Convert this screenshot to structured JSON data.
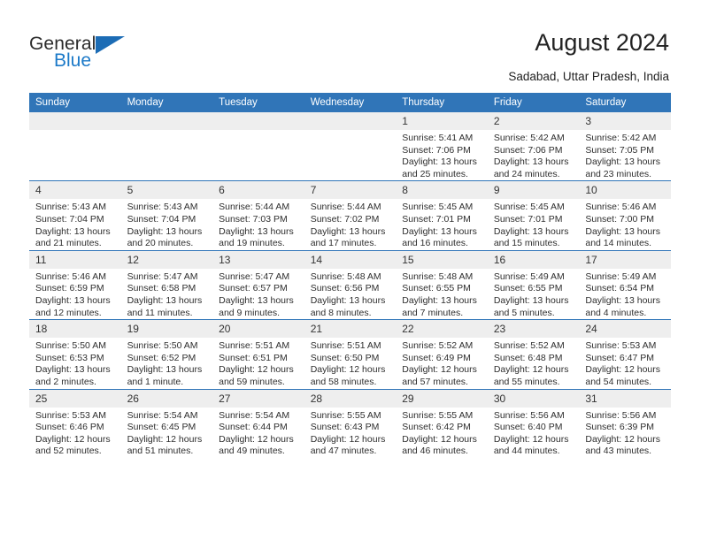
{
  "brand": {
    "name_part1": "General",
    "name_part2": "Blue",
    "logo_icon": "triangle-logo-icon"
  },
  "header": {
    "title": "August 2024",
    "location": "Sadabad, Uttar Pradesh, India"
  },
  "calendar": {
    "weekday_headers": [
      "Sunday",
      "Monday",
      "Tuesday",
      "Wednesday",
      "Thursday",
      "Friday",
      "Saturday"
    ],
    "colors": {
      "header_blue": "#3075b8",
      "daynum_band": "#eeeeee",
      "brand_blue": "#1b79c8",
      "text": "#222222"
    },
    "labels": {
      "sunrise_prefix": "Sunrise:",
      "sunset_prefix": "Sunset:",
      "daylight_prefix": "Daylight:"
    },
    "weeks": [
      [
        {
          "day": "",
          "lines": []
        },
        {
          "day": "",
          "lines": []
        },
        {
          "day": "",
          "lines": []
        },
        {
          "day": "",
          "lines": []
        },
        {
          "day": "1",
          "lines": [
            "Sunrise: 5:41 AM",
            "Sunset: 7:06 PM",
            "Daylight: 13 hours and 25 minutes."
          ]
        },
        {
          "day": "2",
          "lines": [
            "Sunrise: 5:42 AM",
            "Sunset: 7:06 PM",
            "Daylight: 13 hours and 24 minutes."
          ]
        },
        {
          "day": "3",
          "lines": [
            "Sunrise: 5:42 AM",
            "Sunset: 7:05 PM",
            "Daylight: 13 hours and 23 minutes."
          ]
        }
      ],
      [
        {
          "day": "4",
          "lines": [
            "Sunrise: 5:43 AM",
            "Sunset: 7:04 PM",
            "Daylight: 13 hours and 21 minutes."
          ]
        },
        {
          "day": "5",
          "lines": [
            "Sunrise: 5:43 AM",
            "Sunset: 7:04 PM",
            "Daylight: 13 hours and 20 minutes."
          ]
        },
        {
          "day": "6",
          "lines": [
            "Sunrise: 5:44 AM",
            "Sunset: 7:03 PM",
            "Daylight: 13 hours and 19 minutes."
          ]
        },
        {
          "day": "7",
          "lines": [
            "Sunrise: 5:44 AM",
            "Sunset: 7:02 PM",
            "Daylight: 13 hours and 17 minutes."
          ]
        },
        {
          "day": "8",
          "lines": [
            "Sunrise: 5:45 AM",
            "Sunset: 7:01 PM",
            "Daylight: 13 hours and 16 minutes."
          ]
        },
        {
          "day": "9",
          "lines": [
            "Sunrise: 5:45 AM",
            "Sunset: 7:01 PM",
            "Daylight: 13 hours and 15 minutes."
          ]
        },
        {
          "day": "10",
          "lines": [
            "Sunrise: 5:46 AM",
            "Sunset: 7:00 PM",
            "Daylight: 13 hours and 14 minutes."
          ]
        }
      ],
      [
        {
          "day": "11",
          "lines": [
            "Sunrise: 5:46 AM",
            "Sunset: 6:59 PM",
            "Daylight: 13 hours and 12 minutes."
          ]
        },
        {
          "day": "12",
          "lines": [
            "Sunrise: 5:47 AM",
            "Sunset: 6:58 PM",
            "Daylight: 13 hours and 11 minutes."
          ]
        },
        {
          "day": "13",
          "lines": [
            "Sunrise: 5:47 AM",
            "Sunset: 6:57 PM",
            "Daylight: 13 hours and 9 minutes."
          ]
        },
        {
          "day": "14",
          "lines": [
            "Sunrise: 5:48 AM",
            "Sunset: 6:56 PM",
            "Daylight: 13 hours and 8 minutes."
          ]
        },
        {
          "day": "15",
          "lines": [
            "Sunrise: 5:48 AM",
            "Sunset: 6:55 PM",
            "Daylight: 13 hours and 7 minutes."
          ]
        },
        {
          "day": "16",
          "lines": [
            "Sunrise: 5:49 AM",
            "Sunset: 6:55 PM",
            "Daylight: 13 hours and 5 minutes."
          ]
        },
        {
          "day": "17",
          "lines": [
            "Sunrise: 5:49 AM",
            "Sunset: 6:54 PM",
            "Daylight: 13 hours and 4 minutes."
          ]
        }
      ],
      [
        {
          "day": "18",
          "lines": [
            "Sunrise: 5:50 AM",
            "Sunset: 6:53 PM",
            "Daylight: 13 hours and 2 minutes."
          ]
        },
        {
          "day": "19",
          "lines": [
            "Sunrise: 5:50 AM",
            "Sunset: 6:52 PM",
            "Daylight: 13 hours and 1 minute."
          ]
        },
        {
          "day": "20",
          "lines": [
            "Sunrise: 5:51 AM",
            "Sunset: 6:51 PM",
            "Daylight: 12 hours and 59 minutes."
          ]
        },
        {
          "day": "21",
          "lines": [
            "Sunrise: 5:51 AM",
            "Sunset: 6:50 PM",
            "Daylight: 12 hours and 58 minutes."
          ]
        },
        {
          "day": "22",
          "lines": [
            "Sunrise: 5:52 AM",
            "Sunset: 6:49 PM",
            "Daylight: 12 hours and 57 minutes."
          ]
        },
        {
          "day": "23",
          "lines": [
            "Sunrise: 5:52 AM",
            "Sunset: 6:48 PM",
            "Daylight: 12 hours and 55 minutes."
          ]
        },
        {
          "day": "24",
          "lines": [
            "Sunrise: 5:53 AM",
            "Sunset: 6:47 PM",
            "Daylight: 12 hours and 54 minutes."
          ]
        }
      ],
      [
        {
          "day": "25",
          "lines": [
            "Sunrise: 5:53 AM",
            "Sunset: 6:46 PM",
            "Daylight: 12 hours and 52 minutes."
          ]
        },
        {
          "day": "26",
          "lines": [
            "Sunrise: 5:54 AM",
            "Sunset: 6:45 PM",
            "Daylight: 12 hours and 51 minutes."
          ]
        },
        {
          "day": "27",
          "lines": [
            "Sunrise: 5:54 AM",
            "Sunset: 6:44 PM",
            "Daylight: 12 hours and 49 minutes."
          ]
        },
        {
          "day": "28",
          "lines": [
            "Sunrise: 5:55 AM",
            "Sunset: 6:43 PM",
            "Daylight: 12 hours and 47 minutes."
          ]
        },
        {
          "day": "29",
          "lines": [
            "Sunrise: 5:55 AM",
            "Sunset: 6:42 PM",
            "Daylight: 12 hours and 46 minutes."
          ]
        },
        {
          "day": "30",
          "lines": [
            "Sunrise: 5:56 AM",
            "Sunset: 6:40 PM",
            "Daylight: 12 hours and 44 minutes."
          ]
        },
        {
          "day": "31",
          "lines": [
            "Sunrise: 5:56 AM",
            "Sunset: 6:39 PM",
            "Daylight: 12 hours and 43 minutes."
          ]
        }
      ]
    ]
  }
}
